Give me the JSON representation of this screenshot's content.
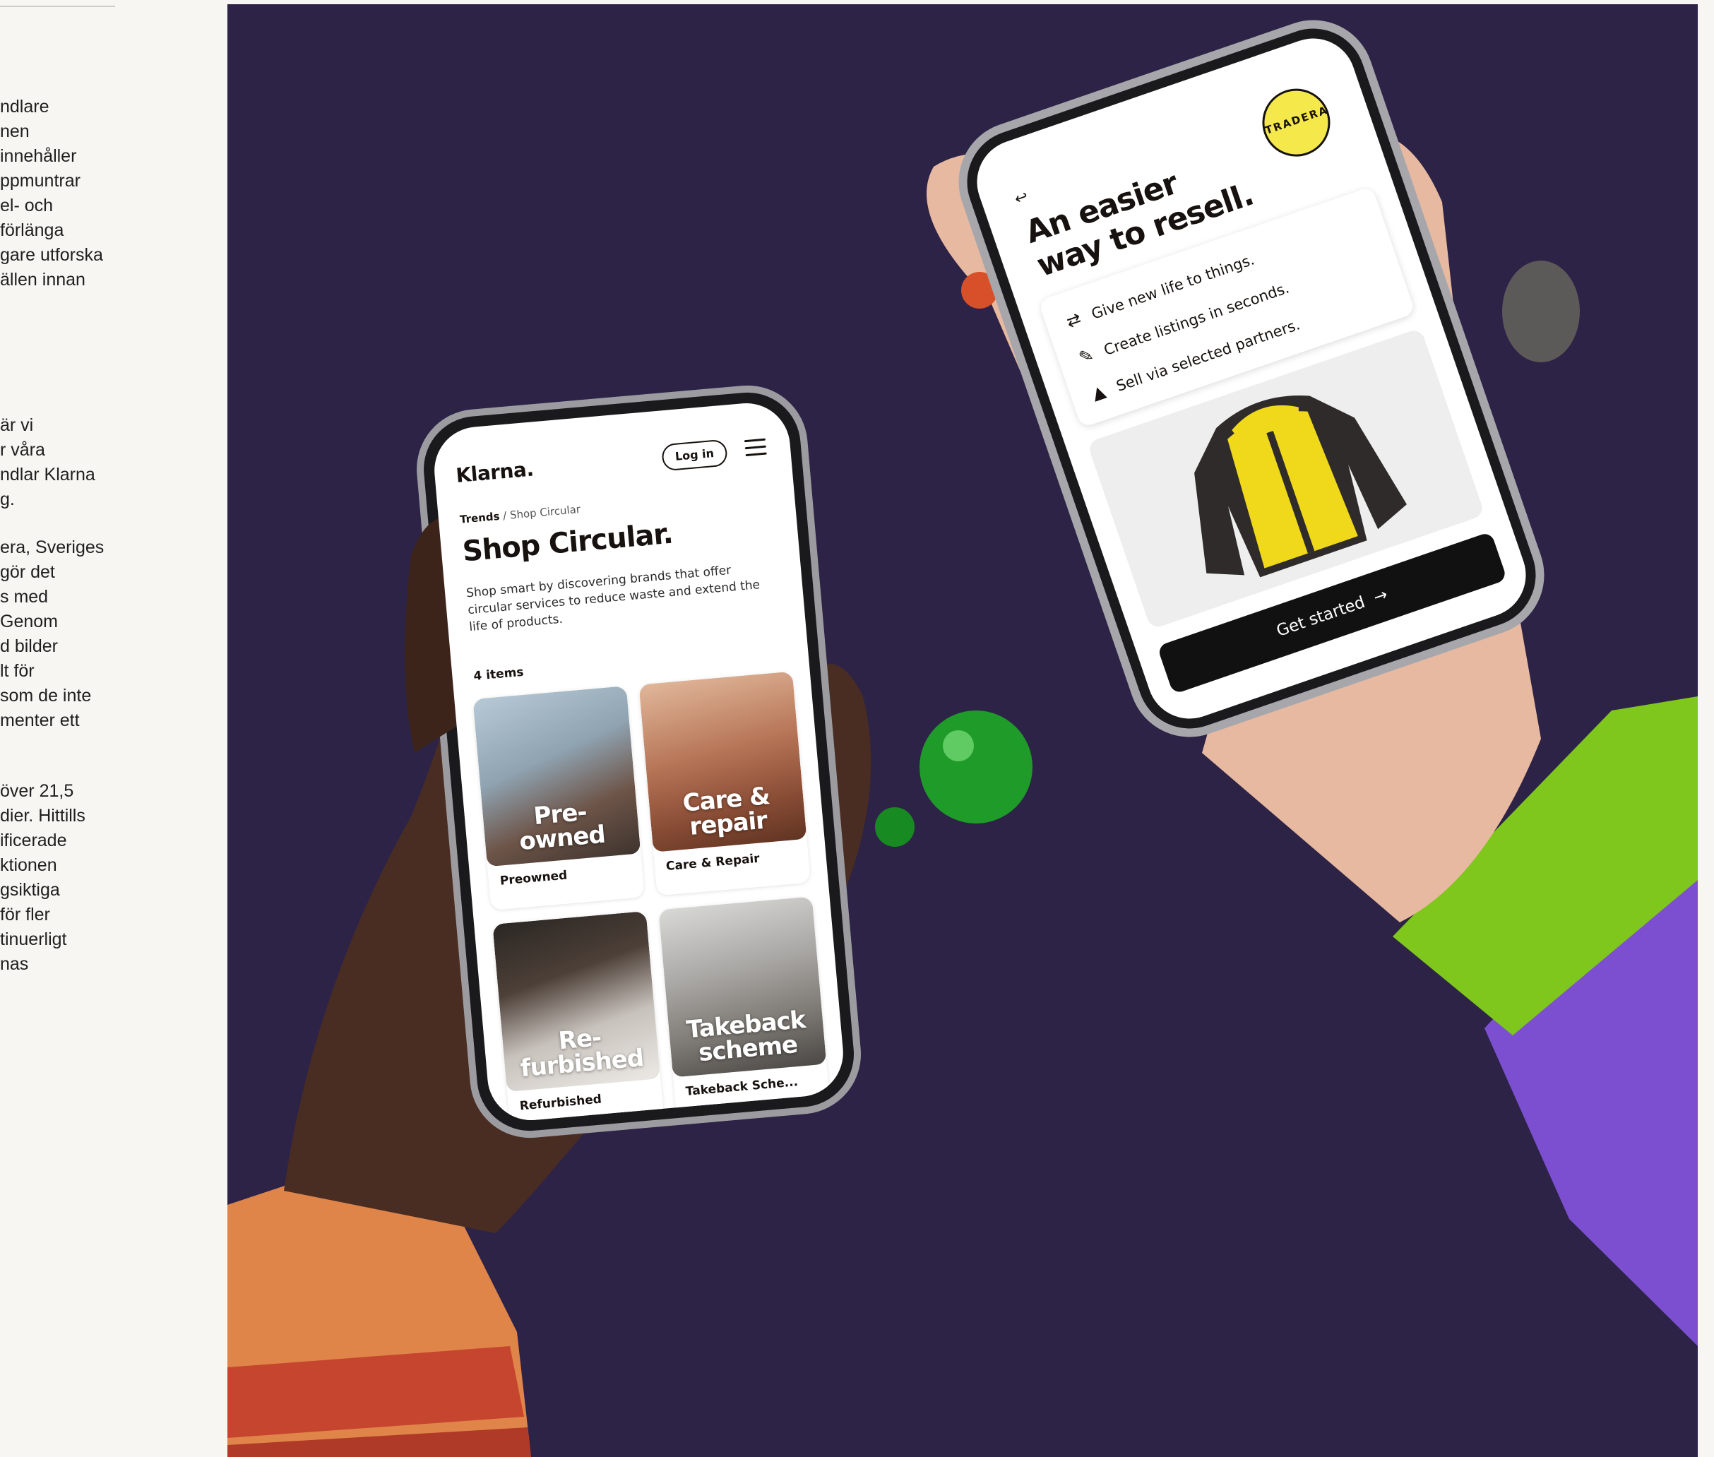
{
  "article": {
    "paragraphs": [
      {
        "lines": [
          "ndlare",
          "nen",
          "innehåller",
          "ppmuntrar",
          "el- och",
          "förlänga",
          "gare utforska",
          "ällen innan"
        ]
      },
      {
        "lines": [
          "är vi",
          "r våra",
          "ndlar Klarna",
          "g."
        ]
      },
      {
        "lines": [
          "era, Sveriges",
          "gör det",
          "s med",
          "Genom",
          "d bilder",
          "lt för",
          "som de inte",
          "menter ett"
        ]
      },
      {
        "lines": [
          "över 21,5",
          "dier. Hittills",
          "ificerade",
          "ktionen",
          "gsiktiga",
          " för fler",
          "tinuerligt",
          "nas"
        ]
      }
    ]
  },
  "phone_left": {
    "logo": "Klarna.",
    "login_label": "Log in",
    "menu_icon": "hamburger-menu-icon",
    "breadcrumb": {
      "current_section": "Trends",
      "separator": "/",
      "page": "Shop Circular"
    },
    "title": "Shop Circular.",
    "description": "Shop smart by discovering brands that offer circular services to reduce waste and extend the life of products.",
    "item_count": "4 items",
    "cards": [
      {
        "overlay": "Pre-\nowned",
        "label": "Preowned"
      },
      {
        "overlay": "Care &\nrepair",
        "label": "Care & Repair"
      },
      {
        "overlay": "Re-\nfurbished",
        "label": "Refurbished"
      },
      {
        "overlay": "Takeback\nscheme",
        "label": "Takeback Sche..."
      }
    ]
  },
  "phone_right": {
    "back_icon": "back-arrow-icon",
    "title_line1": "An easier",
    "title_line2": "way to resell.",
    "badge_text": "TRADERA",
    "features": [
      {
        "icon": "recycle-arrows-icon",
        "text": "Give new life to things."
      },
      {
        "icon": "edit-pen-icon",
        "text": "Create listings in seconds."
      },
      {
        "icon": "megaphone-icon",
        "text": "Sell via selected partners."
      }
    ],
    "cta_label": "Get started",
    "cta_icon": "arrow-right-icon"
  },
  "colors": {
    "page_bg": "#f7f6f3",
    "photo_bg": "#2d2347",
    "tradera_yellow": "#f4e84a",
    "jacket_yellow": "#f0d91a",
    "glass_green": "#1f9b2a"
  }
}
